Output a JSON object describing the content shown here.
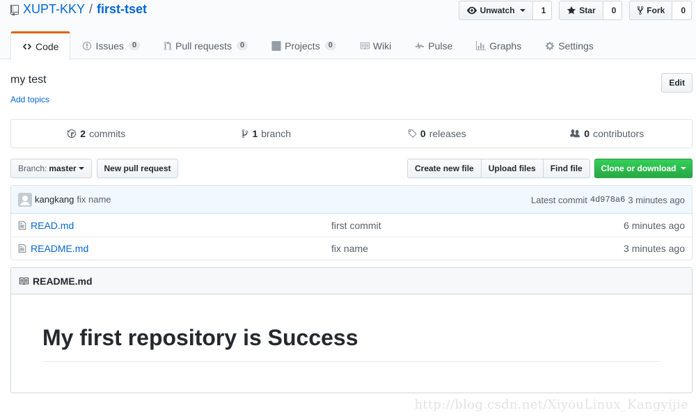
{
  "repo": {
    "owner": "XUPT-KKY",
    "separator": "/",
    "name": "first-tset"
  },
  "actions": {
    "watch": {
      "label": "Unwatch",
      "count": "1"
    },
    "star": {
      "label": "Star",
      "count": "0"
    },
    "fork": {
      "label": "Fork",
      "count": "0"
    }
  },
  "nav": {
    "code": "Code",
    "issues": {
      "label": "Issues",
      "count": "0"
    },
    "pulls": {
      "label": "Pull requests",
      "count": "0"
    },
    "projects": {
      "label": "Projects",
      "count": "0"
    },
    "wiki": "Wiki",
    "pulse": "Pulse",
    "graphs": "Graphs",
    "settings": "Settings"
  },
  "description": "my test",
  "add_topics": "Add topics",
  "edit_label": "Edit",
  "summary": {
    "commits": {
      "count": "2",
      "label": "commits"
    },
    "branches": {
      "count": "1",
      "label": "branch"
    },
    "releases": {
      "count": "0",
      "label": "releases"
    },
    "contributors": {
      "count": "0",
      "label": "contributors"
    }
  },
  "filenav": {
    "branch_label": "Branch:",
    "branch_value": "master",
    "new_pr": "New pull request",
    "create_file": "Create new file",
    "upload": "Upload files",
    "find": "Find file",
    "clone": "Clone or download"
  },
  "commit": {
    "author": "kangkang",
    "message": "fix name",
    "latest_label": "Latest commit",
    "sha": "4d978a6",
    "age": "3 minutes ago"
  },
  "files": [
    {
      "name": "READ.md",
      "message": "first commit",
      "age": "6 minutes ago"
    },
    {
      "name": "README.md",
      "message": "fix name",
      "age": "3 minutes ago"
    }
  ],
  "readme": {
    "title": "README.md",
    "heading": "My first repository is Success"
  },
  "watermark": "http://blog.csdn.net/XiyouLinux_Kangyijie",
  "colors": {
    "link": "#0366d6",
    "selected_tab": "#e36209",
    "clone_button": "#28a745"
  }
}
